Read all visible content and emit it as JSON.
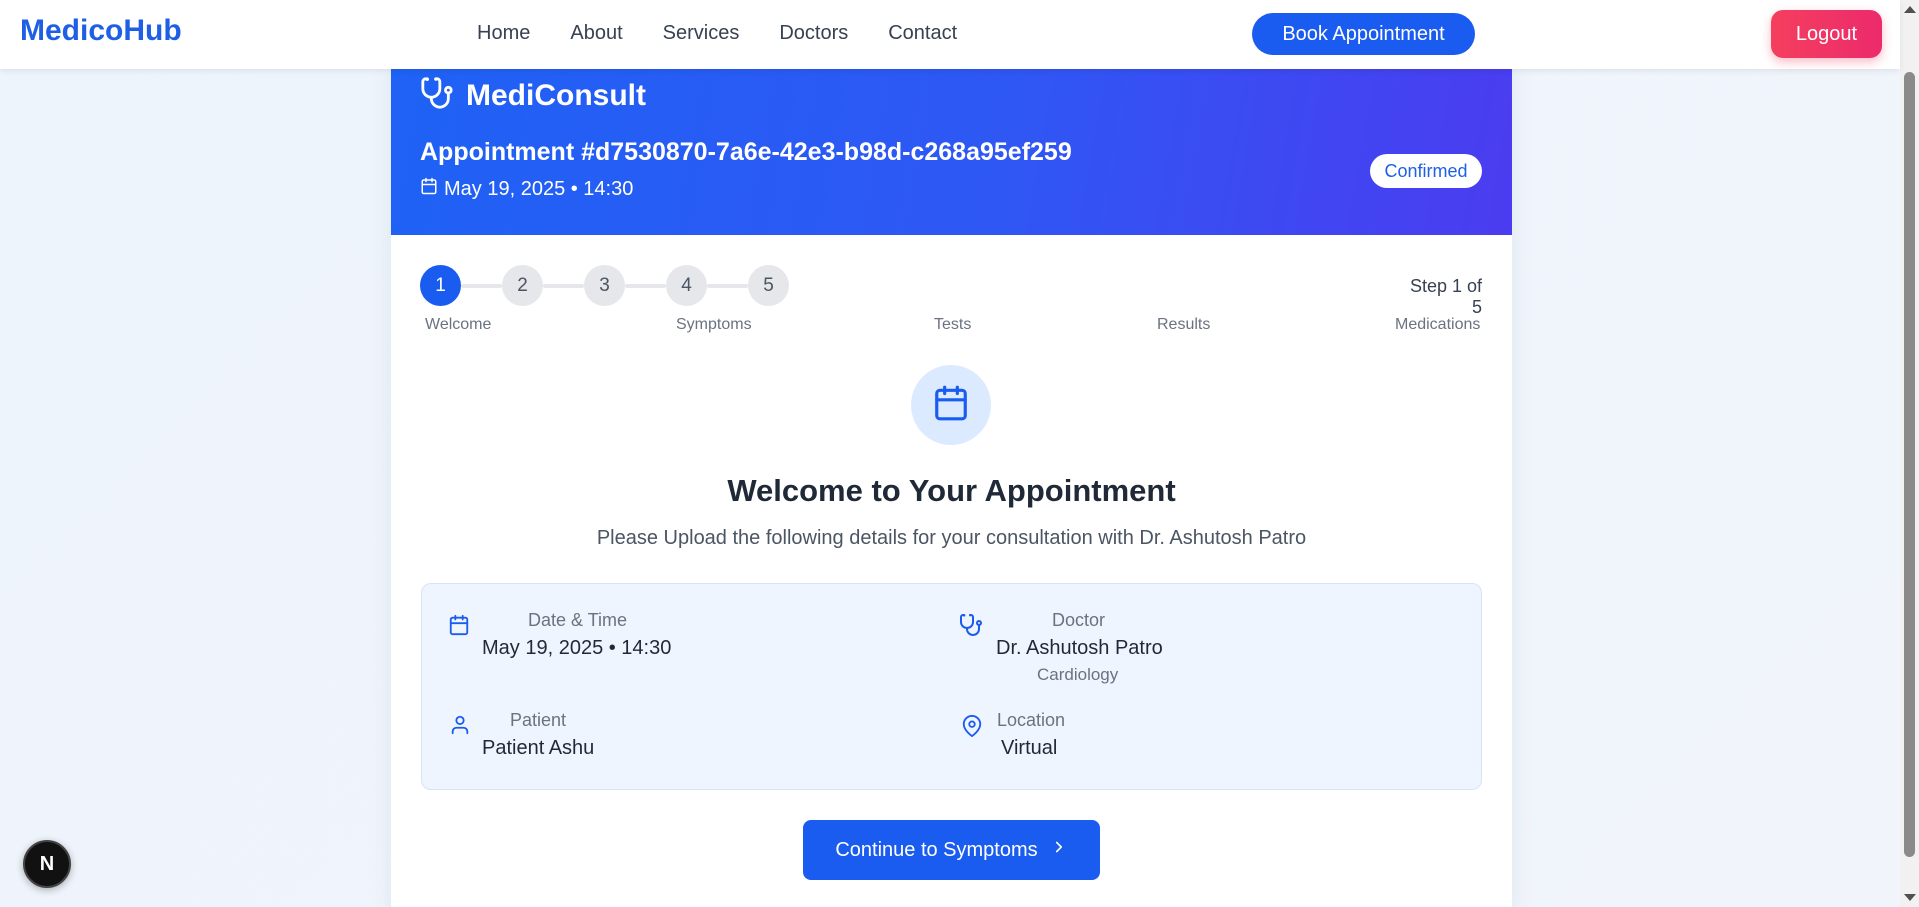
{
  "navbar": {
    "brand": "MedicoHub",
    "links": [
      "Home",
      "About",
      "Services",
      "Doctors",
      "Contact"
    ],
    "book_label": "Book Appointment",
    "logout_label": "Logout"
  },
  "header": {
    "logo_text": "MediConsult",
    "appointment_title": "Appointment #d7530870-7a6e-42e3-b98d-c268a95ef259",
    "appointment_datetime": "May 19, 2025 • 14:30",
    "status": "Confirmed"
  },
  "stepper": {
    "steps": [
      "1",
      "2",
      "3",
      "4",
      "5"
    ],
    "current": 1,
    "counter": "Step 1 of 5",
    "labels": [
      "Welcome",
      "Symptoms",
      "Tests",
      "Results",
      "Medications"
    ]
  },
  "welcome": {
    "title": "Welcome to Your Appointment",
    "subtitle": "Please Upload the following details for your consultation with Dr. Ashutosh Patro"
  },
  "details": {
    "datetime": {
      "label": "Date & Time",
      "value": "May 19, 2025 • 14:30"
    },
    "doctor": {
      "label": "Doctor",
      "value": "Dr. Ashutosh Patro",
      "specialty": "Cardiology"
    },
    "patient": {
      "label": "Patient",
      "value": "Patient Ashu"
    },
    "location": {
      "label": "Location",
      "value": "Virtual"
    }
  },
  "continue_label": "Continue to Symptoms",
  "next_badge": "N",
  "colors": {
    "primary": "#1a5cf0",
    "brand": "#1f5fe6",
    "logout": "#f43f5e"
  }
}
